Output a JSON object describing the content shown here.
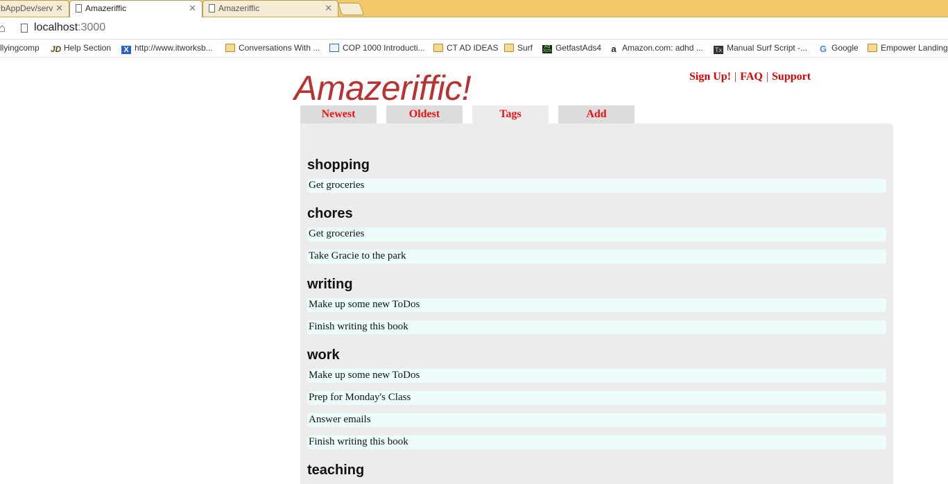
{
  "browser": {
    "tabs": [
      {
        "title": "bAppDev/serv"
      },
      {
        "title": "Amazeriffic"
      },
      {
        "title": "Amazeriffic"
      }
    ],
    "url_host": "localhost",
    "url_port": ":3000",
    "bookmarks": [
      "llyingcomp",
      "Help Section",
      "http://www.itworksb...",
      "Conversations With ...",
      "COP 1000 Introducti...",
      "CT AD IDEAS",
      "Surf",
      "GetfastAds4",
      "Amazon.com: adhd ...",
      "Manual Surf Script -...",
      "Google",
      "Empower Landing"
    ]
  },
  "page": {
    "title": "Amazeriffic!",
    "links": {
      "signup": "Sign Up!",
      "faq": "FAQ",
      "support": "Support",
      "separator": "|"
    },
    "tabs": [
      {
        "label": "Newest"
      },
      {
        "label": "Oldest"
      },
      {
        "label": "Tags"
      },
      {
        "label": "Add"
      }
    ],
    "tags": [
      {
        "name": "shopping",
        "todos": [
          "Get groceries"
        ]
      },
      {
        "name": "chores",
        "todos": [
          "Get groceries",
          "Take Gracie to the park"
        ]
      },
      {
        "name": "writing",
        "todos": [
          "Make up some new ToDos",
          "Finish writing this book"
        ]
      },
      {
        "name": "work",
        "todos": [
          "Make up some new ToDos",
          "Prep for Monday's Class",
          "Answer emails",
          "Finish writing this book"
        ]
      },
      {
        "name": "teaching",
        "todos": []
      }
    ]
  }
}
